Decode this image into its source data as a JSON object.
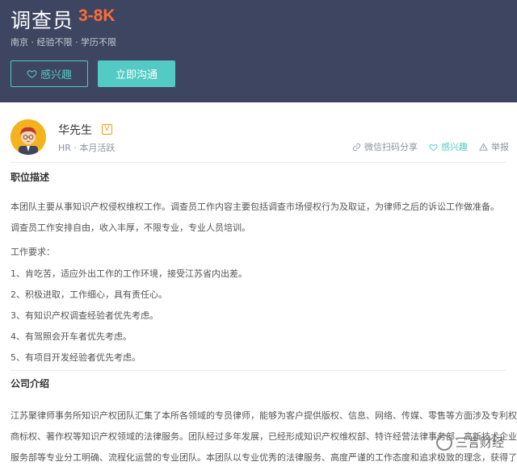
{
  "job": {
    "title": "调查员",
    "salary": "3-8K",
    "meta": "南京 · 经验不限 · 学历不限"
  },
  "buttons": {
    "interest": "感兴趣",
    "chat": "立即沟通"
  },
  "recruiter": {
    "name": "华先生",
    "verify_badge": "V",
    "meta": "HR · 本月活跃",
    "actions": {
      "share": "微信扫码分享",
      "interest": "感兴趣",
      "report": "举报"
    }
  },
  "description": {
    "title": "职位描述",
    "intro": "本团队主要从事知识产权侵权维权工作。调查员工作内容主要包括调查市场侵权行为及取证，为律师之后的诉讼工作做准备。调查员工作安排自由，收入丰厚，不限专业，专业人员培训。",
    "requirements_title": "工作要求：",
    "requirements": [
      "1、肯吃苦，适应外出工作的工作环境，接受江苏省内出差。",
      "2、积极进取，工作细心，具有责任心。",
      "3、有知识产权调查经验者优先考虑。",
      "4、有驾照会开车者优先考虑。",
      "5、有项目开发经验者优先考虑。"
    ]
  },
  "company": {
    "title": "公司介绍",
    "lines": [
      "江苏聚律师事务所知识产权团队汇集了本所各领域的专员律师，能够为客户提供版权、信息、网络、传媒、零售等方面涉及专利权、",
      "商标权、著作权等知识产权领域的法律服务。团队经过多年发展，已经形成知识产权维权部、特许经营法律事务部、高新技术企业咨询",
      "服务部等专业分工明确、流程化运营的专业团队。本团队以专业优秀的法律服务、高度严谨的工作态度和追求极致的理念，获得了客户"
    ]
  },
  "watermark": {
    "text": "三言财经"
  },
  "colors": {
    "header_bg": "#3d4560",
    "accent": "#53cac3",
    "salary": "#fc6c38"
  }
}
